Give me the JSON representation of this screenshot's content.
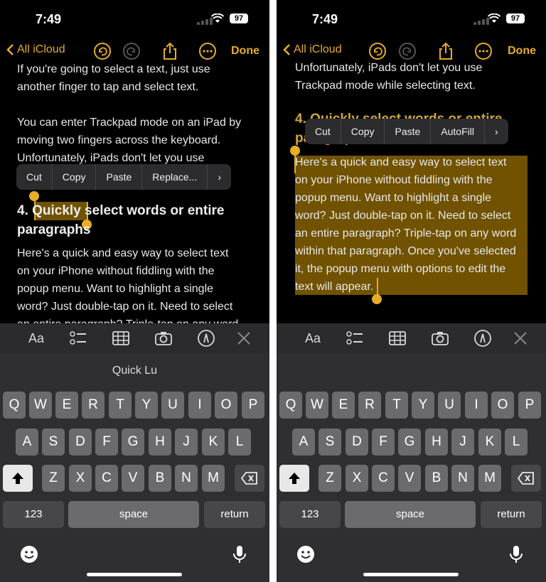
{
  "status": {
    "time": "7:49",
    "battery": "97"
  },
  "nav": {
    "back_label": "All iCloud",
    "done_label": "Done"
  },
  "menu_left": [
    "Cut",
    "Copy",
    "Paste",
    "Replace..."
  ],
  "menu_right": [
    "Cut",
    "Copy",
    "Paste",
    "AutoFill"
  ],
  "menu_more": "›",
  "left": {
    "p1": [
      "If you're going to select a text, just use",
      "another finger to tap and select text."
    ],
    "p2": [
      "You can enter Trackpad mode on an iPad by",
      "moving two fingers across the keyboard.",
      "Unfortunately, iPads don't let you use"
    ],
    "heading_prefix": "4. ",
    "heading_selected": "Quickly",
    "heading_rest": " select words or entire",
    "heading_line2": "paragraphs",
    "p3": [
      "Here's a quick and easy way to select text",
      "on your iPhone without fiddling with the",
      "popup menu. Want to highlight a single",
      "word? Just double-tap on it. Need to select",
      "an entire paragraph? Triple-tap on any word"
    ]
  },
  "right": {
    "p1": [
      "Unfortunately, iPads don't let you use",
      "Trackpad mode while selecting text."
    ],
    "heading_line1": "4. Quickly select words or entire",
    "heading_line2": "paragraphs",
    "p3": [
      "Here's a quick and easy way to select text",
      "on your iPhone without fiddling with the",
      "popup menu. Want to highlight a single",
      "word? Just double-tap on it. Need to select",
      "an entire paragraph? Triple-tap on any word",
      "within that paragraph. Once you've selected",
      "it, the popup menu with options to edit the",
      "text will appear."
    ]
  },
  "toolbar": {
    "format_label": "Aa"
  },
  "keyboard": {
    "suggestion": "Quick Lu",
    "row1": [
      "Q",
      "W",
      "E",
      "R",
      "T",
      "Y",
      "U",
      "I",
      "O",
      "P"
    ],
    "row2": [
      "A",
      "S",
      "D",
      "F",
      "G",
      "H",
      "J",
      "K",
      "L"
    ],
    "row3": [
      "Z",
      "X",
      "C",
      "V",
      "B",
      "N",
      "M"
    ],
    "numbers": "123",
    "space": "space",
    "return": "return"
  },
  "colors": {
    "accent": "#e6ad25",
    "selection": "#8a6a00",
    "background": "#000000"
  }
}
